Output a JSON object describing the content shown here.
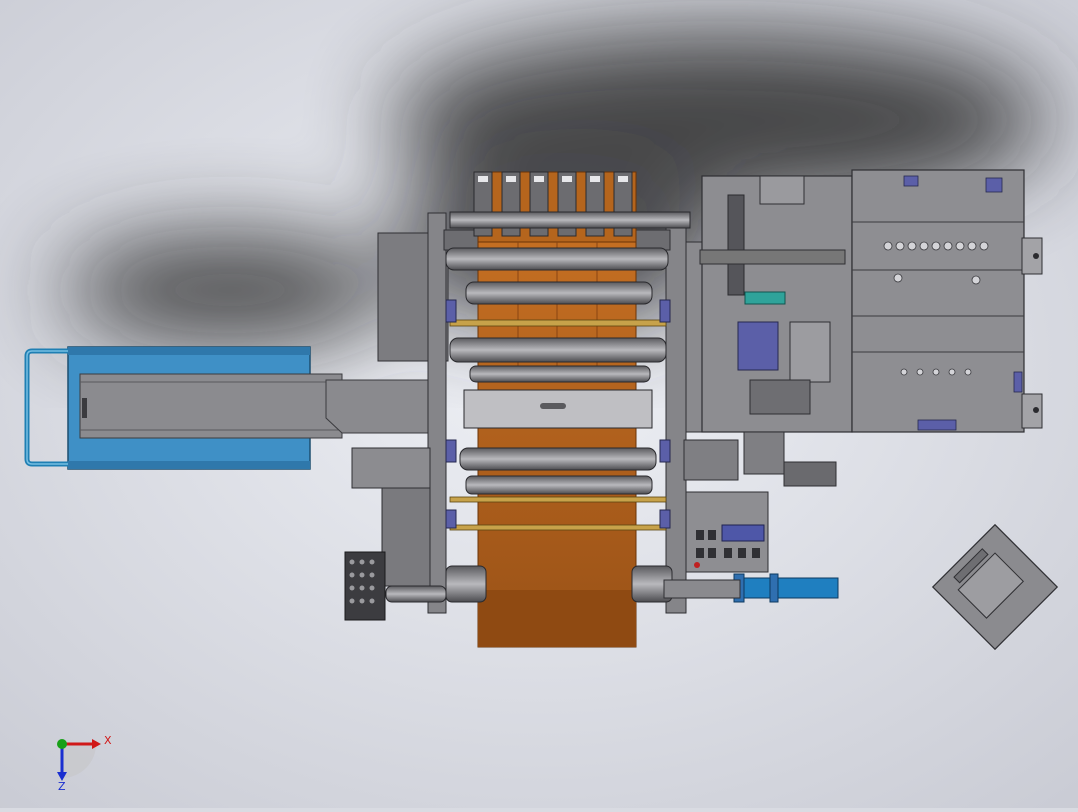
{
  "viewport": {
    "background_color": "#d9dbe2",
    "scene": "cad-machine-top-view"
  },
  "triad": {
    "x_label": "X",
    "z_label": "Z",
    "x_color": "#d01818",
    "y_color": "#18a018",
    "z_color": "#1a2fd0"
  },
  "colors": {
    "film": "#b5651d",
    "film_dark": "#8f4a12",
    "frame": "#7e7e82",
    "frame_dark": "#4a4a4e",
    "panel": "#8f8f93",
    "blue_part": "#3f90c6",
    "purple_part": "#5b5fa8",
    "teal_part": "#2fa39a"
  }
}
